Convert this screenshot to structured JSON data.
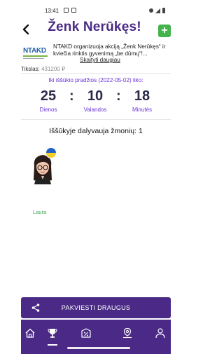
{
  "status": {
    "time": "13:41"
  },
  "header": {
    "title": "Ženk Nerūkęs!",
    "back_icon": "arrow-left-icon",
    "add_label": "+"
  },
  "organizer": {
    "logo_text": "NTAKD",
    "description": "NTAKD organizuoja akciją „Ženk Nerūkęs“ ir kviečia rinktis gyvenimą „be dūmų“!...",
    "read_more": "Skaityti daugiau",
    "target_label": "Tikslas:",
    "target_value": "431200 ₽"
  },
  "countdown": {
    "label": "Iki iššūkio pradžios (2022-05-02) liko:",
    "days": "25",
    "days_label": "Dienos",
    "hours": "10",
    "hours_label": "Valandos",
    "minutes": "18",
    "minutes_label": "Minutės",
    "separator": ":"
  },
  "participants": {
    "heading": "Iššūkyje dalyvauja žmonių: 1",
    "list": [
      {
        "name": "Laura"
      }
    ]
  },
  "invite": {
    "label": "PAKVIESTI DRAUGUS",
    "icon": "share-icon"
  },
  "tabs": [
    {
      "icon": "home-icon",
      "active": false
    },
    {
      "icon": "trophy-icon",
      "active": true
    },
    {
      "icon": "percent-icon",
      "active": false
    },
    {
      "icon": "location-icon",
      "active": false
    },
    {
      "icon": "user-icon",
      "active": false
    }
  ],
  "colors": {
    "primary": "#4a2a86",
    "accent": "#6b34d8",
    "success": "#43b34b"
  }
}
